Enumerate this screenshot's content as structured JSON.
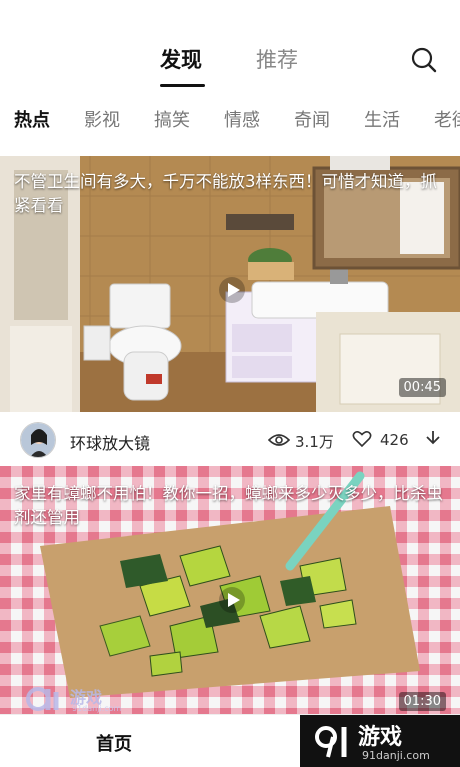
{
  "top_tabs": {
    "discover": "发现",
    "recommend": "推荐",
    "search_icon": "search-icon"
  },
  "categories": [
    "热点",
    "影视",
    "搞笑",
    "情感",
    "奇闻",
    "生活",
    "老街"
  ],
  "videos": [
    {
      "title": "不管卫生间有多大，千万不能放3样东西！可惜才知道，抓紧看看",
      "duration": "00:45",
      "thumbnail": "bathroom-scene",
      "author": "环球放大镜",
      "views": "3.1万",
      "likes": "426"
    },
    {
      "title": "家里有蟑螂不用怕！教你一招，蟑螂来多少灭多少，比杀虫剂还管用",
      "duration": "01:30",
      "thumbnail": "chopped-cucumber-on-cardboard"
    }
  ],
  "bottom_nav": {
    "home": "首页"
  },
  "watermark": {
    "brand": "游戏",
    "url": "91danji.com"
  },
  "colors": {
    "accent": "#111111",
    "inactive": "#888888"
  }
}
